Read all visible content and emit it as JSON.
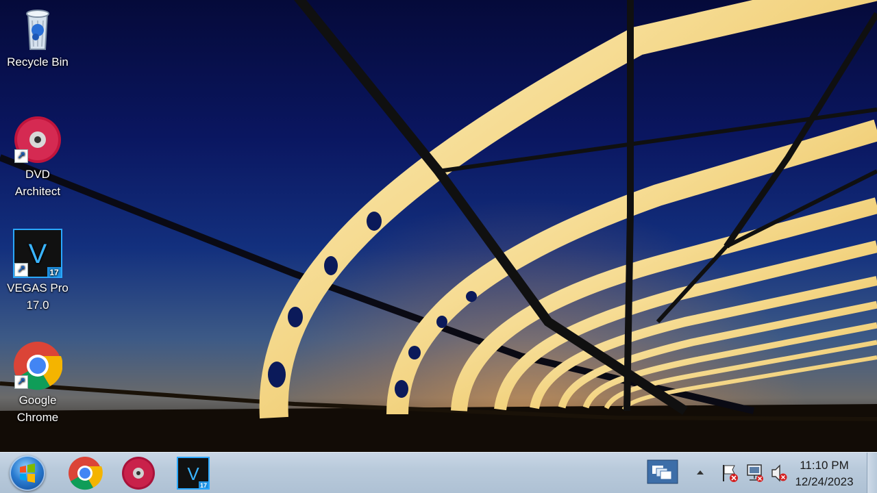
{
  "desktop": {
    "icons": [
      {
        "label_line1": "Recycle Bin",
        "label_line2": "",
        "icon": "recycle-bin-icon"
      },
      {
        "label_line1": "DVD",
        "label_line2": "Architect",
        "icon": "dvd-architect-icon"
      },
      {
        "label_line1": "VEGAS Pro",
        "label_line2": "17.0",
        "icon": "vegas-pro-icon"
      },
      {
        "label_line1": "Google",
        "label_line2": "Chrome",
        "icon": "google-chrome-icon"
      }
    ]
  },
  "taskbar": {
    "start": {
      "icon": "windows-start-icon"
    },
    "pinned": [
      {
        "icon": "google-chrome-icon"
      },
      {
        "icon": "dvd-architect-icon"
      },
      {
        "icon": "vegas-pro-icon",
        "badge": "17",
        "active": true
      }
    ],
    "tray": {
      "icons": [
        "task-switcher-icon",
        "show-hidden-icons-arrow",
        "action-center-flag-icon",
        "network-icon",
        "volume-muted-icon"
      ],
      "time": "11:10 PM",
      "date": "12/24/2023"
    }
  },
  "vegas_badge": "17",
  "vegas_letter": "V",
  "colors": {
    "vegas_bg": "#111111",
    "vegas_border": "#2aa8ff",
    "dvd_disc": "#c0143c",
    "taskbar": "#b9cadb"
  }
}
